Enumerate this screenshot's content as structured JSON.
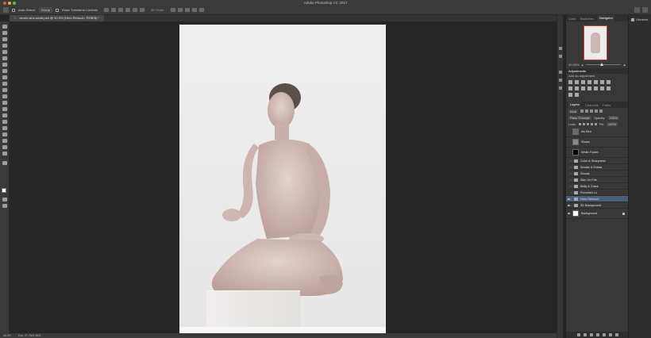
{
  "app": {
    "title": "Adobe Photoshop CC 2017"
  },
  "options_bar": {
    "auto_select_label": "Auto-Select:",
    "auto_select_value": "Group",
    "show_transform_label": "Show Transform Controls",
    "mode_3d_label": "3D Mode:"
  },
  "document": {
    "tab_label": "seven-sins-small.psd @ 40.3% (Hero Retouch, RGB/8) *",
    "close_glyph": "×"
  },
  "status": {
    "zoom": "40.3%",
    "doc_info": "Doc: 27.7M/1.61G"
  },
  "panels": {
    "top_tabs": [
      "Color",
      "Swatches",
      "Navigator"
    ],
    "active_top_tab": "Navigator",
    "navigator_zoom": "40.33%",
    "adjustments_title": "Adjustments",
    "adjustments_hint": "Add an adjustment",
    "layers_tabs": [
      "Layers",
      "Channels",
      "Paths"
    ],
    "active_layers_tab": "Layers",
    "filter_kind": "Kind",
    "blend_mode": "Pass Through",
    "opacity_label": "Opacity:",
    "opacity_value": "100%",
    "lock_label": "Lock:",
    "fill_label": "Fill:",
    "fill_value": "100%",
    "layers": [
      {
        "name": "Iris Blur",
        "type": "smart",
        "visible": false
      },
      {
        "name": "Shoes",
        "type": "pixel",
        "visible": false
      },
      {
        "name": "White Footer",
        "type": "pixel",
        "visible": false
      },
      {
        "name": "Color & Sharpness",
        "type": "group",
        "visible": false
      },
      {
        "name": "Smoke & Extras",
        "type": "group",
        "visible": false
      },
      {
        "name": "Shoots",
        "type": "group",
        "visible": false
      },
      {
        "name": "Skin On File",
        "type": "group",
        "visible": false
      },
      {
        "name": "Belly & Crack",
        "type": "group",
        "visible": false
      },
      {
        "name": "Porcelain Lo",
        "type": "group",
        "visible": false
      },
      {
        "name": "Hero Retouch",
        "type": "group",
        "visible": true,
        "selected": true
      },
      {
        "name": "3D Background",
        "type": "group",
        "visible": true
      },
      {
        "name": "Background",
        "type": "pixel",
        "visible": true,
        "locked": true
      }
    ],
    "libraries_label": "Libraries"
  },
  "colors": {
    "selected_layer": "#4b5f79",
    "foreground": "#ffffff",
    "background": "#1a1a1a"
  }
}
